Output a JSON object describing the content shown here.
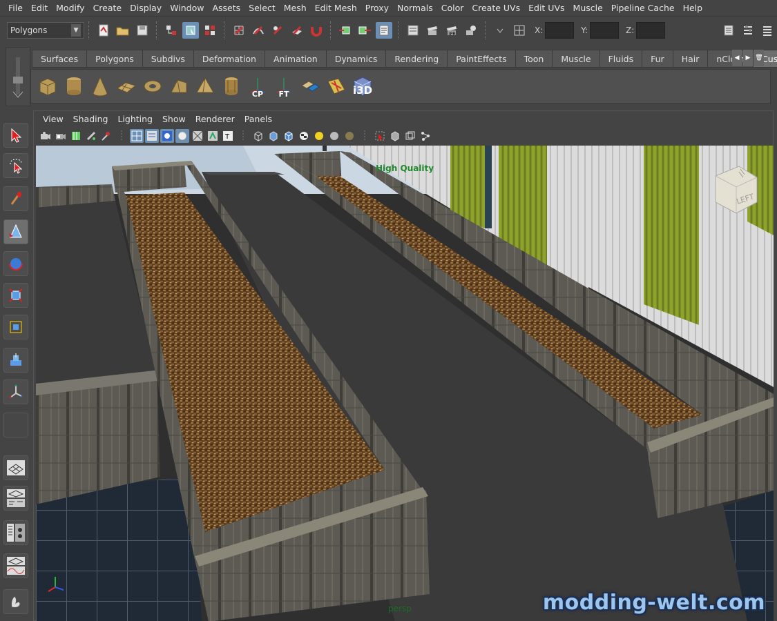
{
  "menus": [
    "File",
    "Edit",
    "Modify",
    "Create",
    "Display",
    "Window",
    "Assets",
    "Select",
    "Mesh",
    "Edit Mesh",
    "Proxy",
    "Normals",
    "Color",
    "Create UVs",
    "Edit UVs",
    "Muscle",
    "Pipeline Cache",
    "Help"
  ],
  "status_line": {
    "mode": "Polygons",
    "x_label": "X:",
    "y_label": "Y:",
    "z_label": "Z:",
    "x_value": "",
    "y_value": "",
    "z_value": ""
  },
  "shelf": {
    "tabs": [
      "Surfaces",
      "Polygons",
      "Subdivs",
      "Deformation",
      "Animation",
      "Dynamics",
      "Rendering",
      "PaintEffects",
      "Toon",
      "Muscle",
      "Fluids",
      "Fur",
      "Hair",
      "nCloth",
      "Custom"
    ],
    "active_tab": "Custom",
    "icon_labels": {
      "cp": "CP",
      "ft": "FT",
      "i3d": "i3D"
    }
  },
  "panel": {
    "menus": [
      "View",
      "Shading",
      "Lighting",
      "Show",
      "Renderer",
      "Panels"
    ]
  },
  "viewport": {
    "hud_quality": "High Quality",
    "camera_name": "persp",
    "viewcube_face": "LEFT",
    "watermark": "modding-welt.com"
  },
  "colors": {
    "selection_blue": "#6b8fb5",
    "hud_green": "#1f8a2b",
    "watermark": "#9cc6ee"
  }
}
